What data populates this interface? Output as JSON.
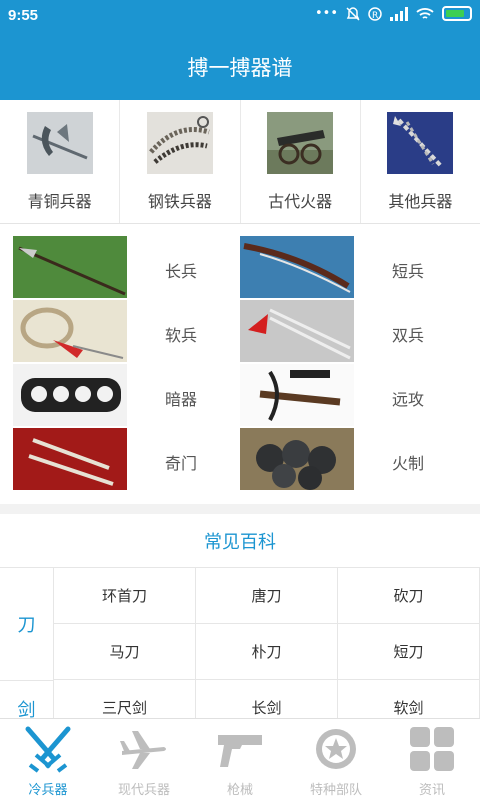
{
  "status": {
    "time": "9:55",
    "icons": [
      "dots-icon",
      "mute-icon",
      "registered-icon",
      "signal-icon",
      "wifi-icon",
      "battery-icon"
    ]
  },
  "header": {
    "title": "搏一搏器谱"
  },
  "categories": [
    {
      "label": "青铜兵器",
      "icon": "bronze-halberd-image"
    },
    {
      "label": "钢铁兵器",
      "icon": "steel-whip-image"
    },
    {
      "label": "古代火器",
      "icon": "cannon-image"
    },
    {
      "label": "其他兵器",
      "icon": "chain-weapon-image"
    }
  ],
  "weapons": [
    {
      "label": "长兵",
      "image": "spear-image"
    },
    {
      "label": "短兵",
      "image": "sword-image"
    },
    {
      "label": "软兵",
      "image": "rope-dart-image"
    },
    {
      "label": "双兵",
      "image": "twin-swords-image"
    },
    {
      "label": "暗器",
      "image": "knuckle-duster-image"
    },
    {
      "label": "远攻",
      "image": "crossbow-image"
    },
    {
      "label": "奇门",
      "image": "emei-pierce-image"
    },
    {
      "label": "火制",
      "image": "iron-balls-image"
    }
  ],
  "encyclopedia": {
    "title": "常见百科",
    "groups": [
      {
        "category": "刀",
        "items": [
          "环首刀",
          "唐刀",
          "砍刀",
          "马刀",
          "朴刀",
          "短刀"
        ]
      },
      {
        "category": "剑",
        "items": [
          "三尺剑",
          "长剑",
          "软剑"
        ]
      }
    ]
  },
  "tabs": [
    {
      "label": "冷兵器",
      "icon": "crossed-swords-icon",
      "active": true
    },
    {
      "label": "现代兵器",
      "icon": "airplane-icon",
      "active": false
    },
    {
      "label": "枪械",
      "icon": "pistol-icon",
      "active": false
    },
    {
      "label": "特种部队",
      "icon": "star-badge-icon",
      "active": false
    },
    {
      "label": "资讯",
      "icon": "grid-icon",
      "active": false
    }
  ],
  "colors": {
    "primary": "#1c95d1",
    "tab_inactive": "#bdbdbd",
    "battery": "#3ccf52"
  }
}
